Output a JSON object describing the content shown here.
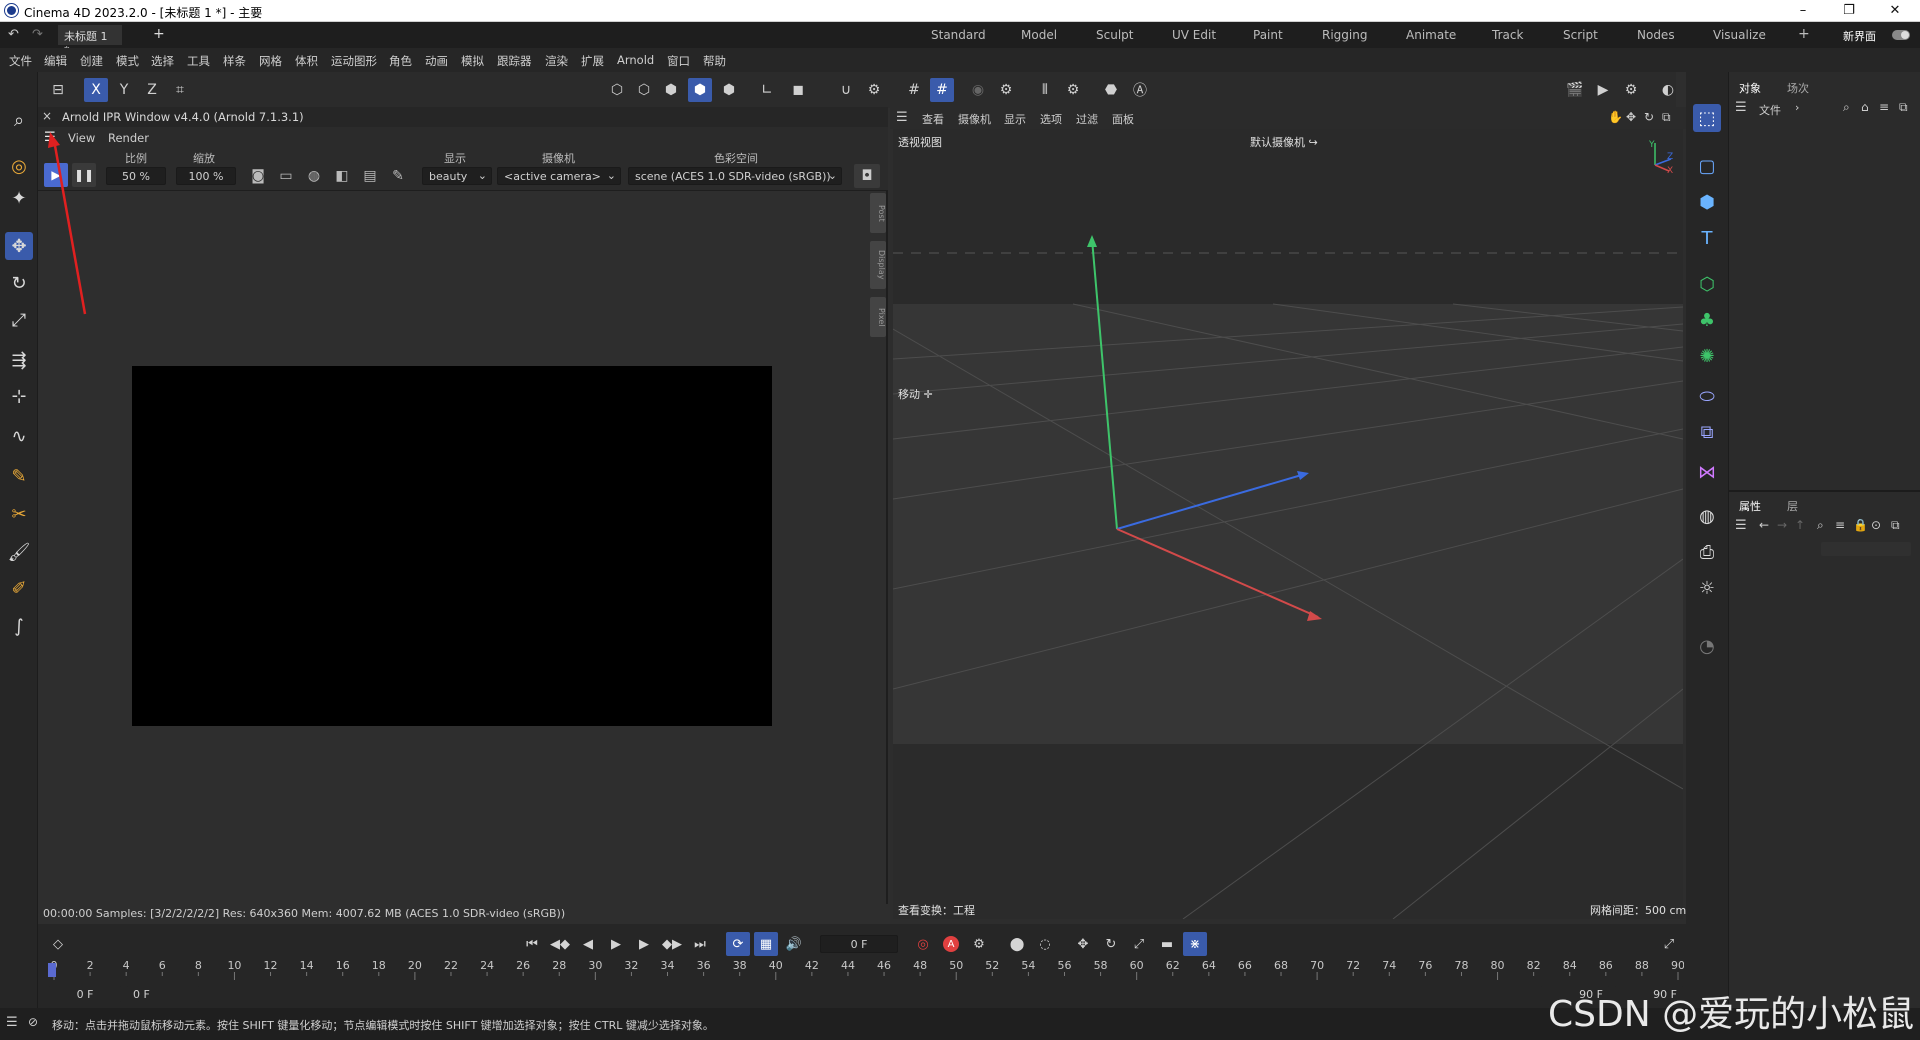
{
  "window": {
    "title": "Cinema 4D 2023.2.0 - [未标题 1 *] - 主要",
    "min": "–",
    "max": "❐",
    "close": "✕"
  },
  "tabs": {
    "doc": "未标题 1 *",
    "add": "+"
  },
  "layouts": [
    "Standard",
    "Model",
    "Sculpt",
    "UV Edit",
    "Paint",
    "Rigging",
    "Animate",
    "Track",
    "Script",
    "Nodes",
    "Visualize"
  ],
  "layout_add": "+",
  "new_interface": "新界面",
  "menu": [
    "文件",
    "编辑",
    "创建",
    "模式",
    "选择",
    "工具",
    "样条",
    "网格",
    "体积",
    "运动图形",
    "角色",
    "动画",
    "模拟",
    "跟踪器",
    "渲染",
    "扩展",
    "Arnold",
    "窗口",
    "帮助"
  ],
  "axis_buttons": {
    "x": "X",
    "y": "Y",
    "z": "Z"
  },
  "ipr": {
    "title": "Arnold IPR Window v4.4.0 (Arnold 7.1.3.1)",
    "close": "×",
    "menu_view": "View",
    "menu_render": "Render",
    "scale_label": "比例",
    "scale_value": "50 %",
    "zoom_label": "缩放",
    "zoom_value": "100 %",
    "display_label": "显示",
    "display_value": "beauty",
    "camera_label": "摄像机",
    "camera_value": "<active camera>",
    "colorspace_label": "色彩空间",
    "colorspace_value": "scene (ACES 1.0 SDR-video (sRGB))",
    "side_tabs": [
      "Post",
      "Display",
      "Pixel"
    ],
    "status": "00:00:00  Samples: [3/2/2/2/2/2]  Res: 640x360  Mem: 4007.62 MB  (ACES 1.0 SDR-video (sRGB))"
  },
  "viewport": {
    "menu": [
      "查看",
      "摄像机",
      "显示",
      "选项",
      "过滤",
      "面板"
    ],
    "name": "透视视图",
    "camera": "默认摄像机",
    "move_label": "移动",
    "view_transform": "查看变换：工程",
    "grid_spacing": "网格间距：500 cm",
    "axis_y": "Y",
    "axis_z": "Z",
    "axis_x": "X"
  },
  "objects_panel": {
    "tab1": "对象",
    "tab2": "场次",
    "file": "文件"
  },
  "attributes_panel": {
    "tab1": "属性",
    "tab2": "层"
  },
  "timeline": {
    "frame": "0 F",
    "start": "0 F",
    "start2": "0 F",
    "end": "90 F",
    "end2": "90 F",
    "ticks": [
      "0",
      "2",
      "4",
      "6",
      "8",
      "10",
      "12",
      "14",
      "16",
      "18",
      "20",
      "22",
      "24",
      "26",
      "28",
      "30",
      "32",
      "34",
      "36",
      "38",
      "40",
      "42",
      "44",
      "46",
      "48",
      "50",
      "52",
      "54",
      "56",
      "58",
      "60",
      "62",
      "64",
      "66",
      "68",
      "70",
      "72",
      "74",
      "76",
      "78",
      "80",
      "82",
      "84",
      "86",
      "88",
      "90"
    ]
  },
  "status_bar": "移动：点击并拖动鼠标移动元素。按住 SHIFT 键量化移动；节点编辑模式时按住 SHIFT 键增加选择对象；按住 CTRL 键减少选择对象。",
  "watermark": "CSDN @爱玩的小松鼠",
  "colors": {
    "accent": "#3a5bab",
    "axis_x": "#d24a4a",
    "axis_y": "#3ec46a",
    "axis_z": "#3a6be0",
    "arrow": "#e02020"
  }
}
